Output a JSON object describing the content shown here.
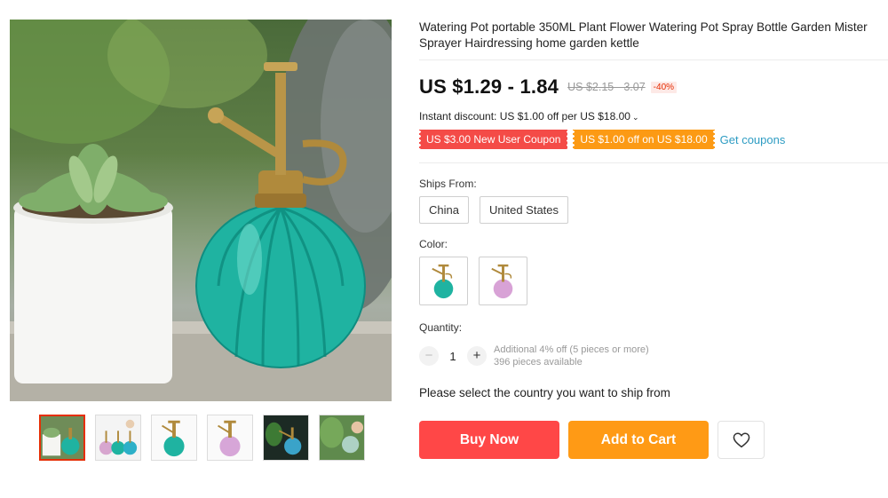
{
  "product": {
    "title": "Watering Pot portable 350ML Plant Flower Watering Pot Spray Bottle Garden Mister Sprayer Hairdressing home garden kettle",
    "price": "US $1.29 - 1.84",
    "original_price": "US $2.15 - 3.07",
    "discount_badge": "-40%"
  },
  "promotions": {
    "instant_discount": "Instant discount: US $1.00 off per US $18.00",
    "coupons": [
      "US $3.00 New User Coupon",
      "US $1.00 off on US $18.00"
    ],
    "get_coupons_label": "Get coupons"
  },
  "shipping": {
    "label": "Ships From:",
    "options": [
      "China",
      "United States"
    ]
  },
  "color": {
    "label": "Color:",
    "options": [
      "teal",
      "pink"
    ]
  },
  "quantity": {
    "label": "Quantity:",
    "value": "1",
    "minus": "−",
    "plus": "+",
    "note_line1": "Additional 4% off (5 pieces or more)",
    "note_line2": "396 pieces available"
  },
  "ship_prompt": "Please select the country you want to ship from",
  "actions": {
    "buy_now": "Buy Now",
    "add_to_cart": "Add to Cart"
  },
  "icons": {
    "wishlist": "heart-icon",
    "dropdown": "chevron-down-icon"
  },
  "colors": {
    "buy_now": "#ff4747",
    "add_to_cart": "#ff9a15",
    "coupon_red": "#f44b47",
    "coupon_orange": "#fc9a14",
    "link": "#2e9cc3",
    "accent_border": "#e62e04"
  },
  "gallery": {
    "thumbnail_count": 6,
    "active_index": 0
  }
}
